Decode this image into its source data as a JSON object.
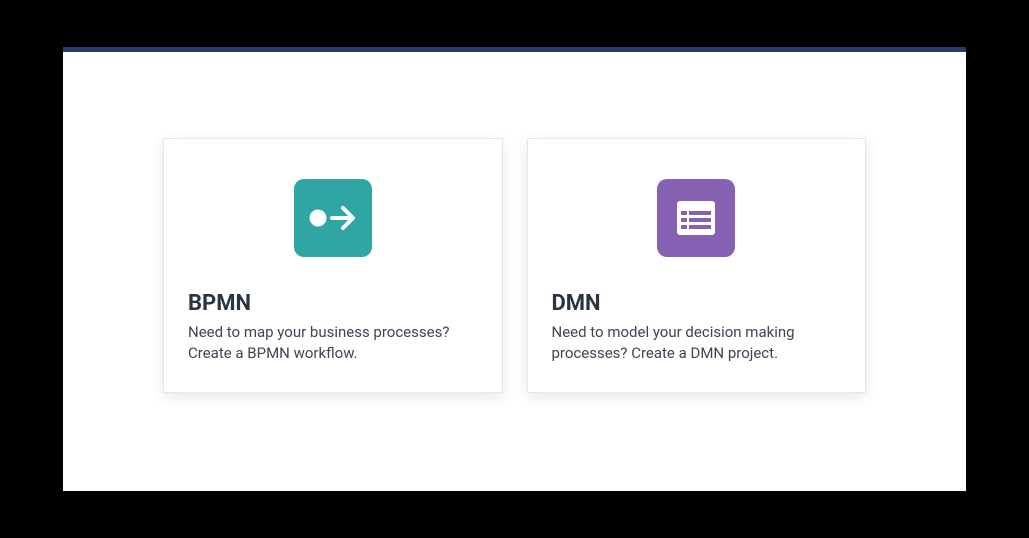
{
  "cards": {
    "bpmn": {
      "title": "BPMN",
      "description": "Need to map your business processes? Create a BPMN workflow.",
      "iconColor": "#2fa6a4"
    },
    "dmn": {
      "title": "DMN",
      "description": "Need to model your decision making processes? Create a DMN project.",
      "iconColor": "#8660b3"
    }
  }
}
